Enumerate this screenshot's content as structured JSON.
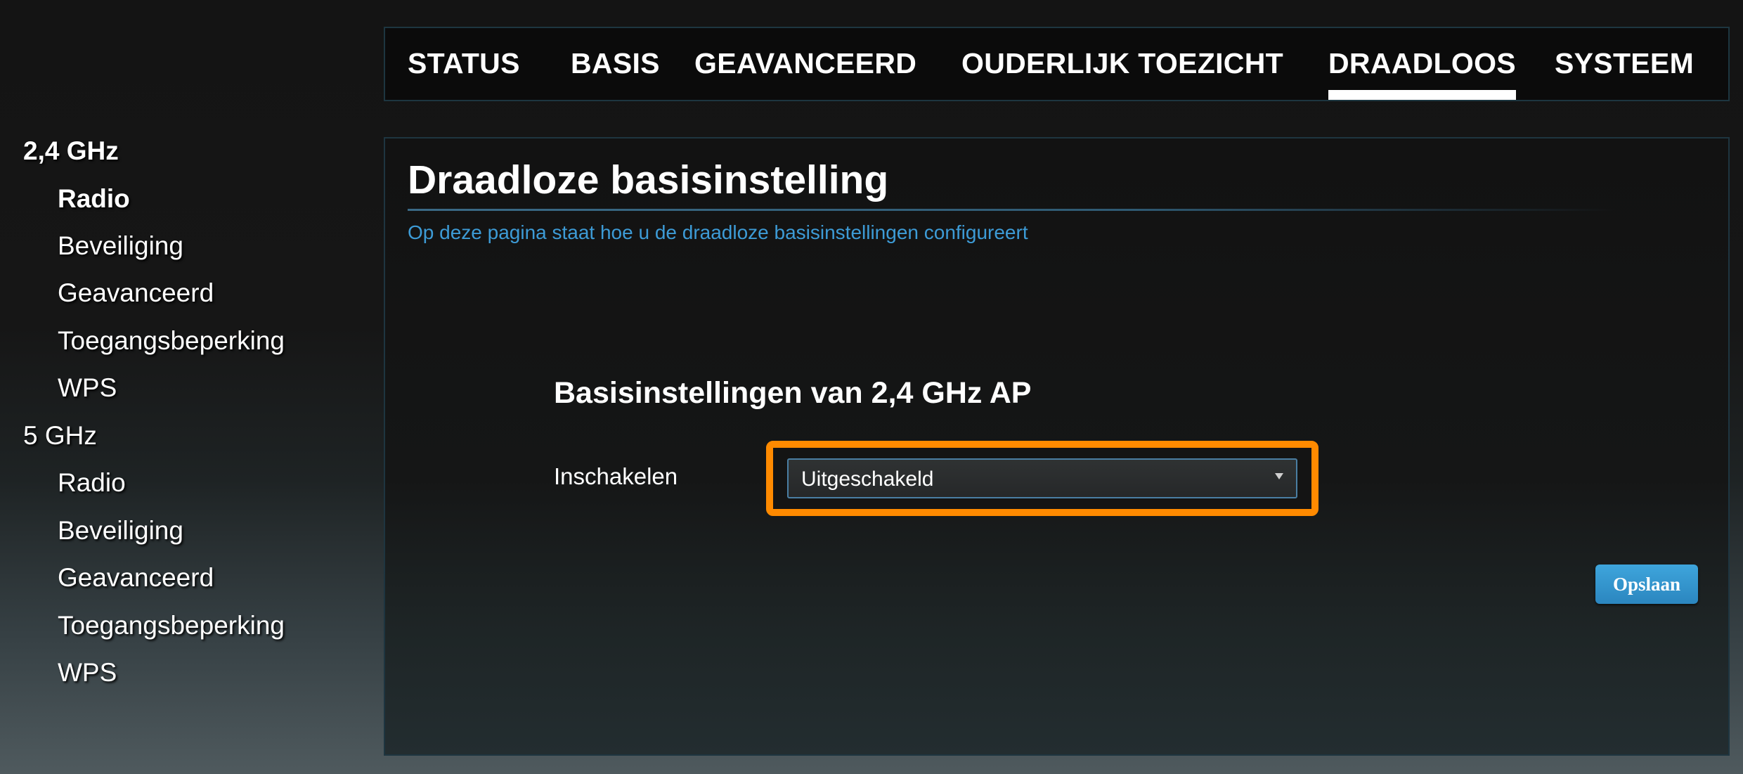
{
  "topnav": {
    "tabs": [
      {
        "label": "STATUS",
        "active": false
      },
      {
        "label": "BASIS",
        "active": false
      },
      {
        "label": "GEAVANCEERD",
        "active": false
      },
      {
        "label": "OUDERLIJK TOEZICHT",
        "active": false
      },
      {
        "label": "DRAADLOOS",
        "active": true
      },
      {
        "label": "SYSTEEM",
        "active": false
      }
    ]
  },
  "sidebar": {
    "groups": [
      {
        "label": "2,4 GHz",
        "items": [
          "Radio",
          "Beveiliging",
          "Geavanceerd",
          "Toegangsbeperking",
          "WPS"
        ],
        "selected_item": "Radio"
      },
      {
        "label": "5 GHz",
        "items": [
          "Radio",
          "Beveiliging",
          "Geavanceerd",
          "Toegangsbeperking",
          "WPS"
        ]
      }
    ]
  },
  "main": {
    "title": "Draadloze basisinstelling",
    "description": "Op deze pagina staat hoe u de draadloze basisinstellingen configureert",
    "section_title": "Basisinstellingen van 2,4 GHz AP",
    "enable_field": {
      "label": "Inschakelen",
      "value": "Uitgeschakeld",
      "highlighted": true
    },
    "save_label": "Opslaan"
  },
  "colors": {
    "background": "#161616",
    "accent_blue": "#3d9bd6",
    "highlight_orange": "#ff8a00",
    "button_blue": "#3ea5dc"
  },
  "icons": {
    "select_arrow": "dropdown-arrow-icon"
  }
}
